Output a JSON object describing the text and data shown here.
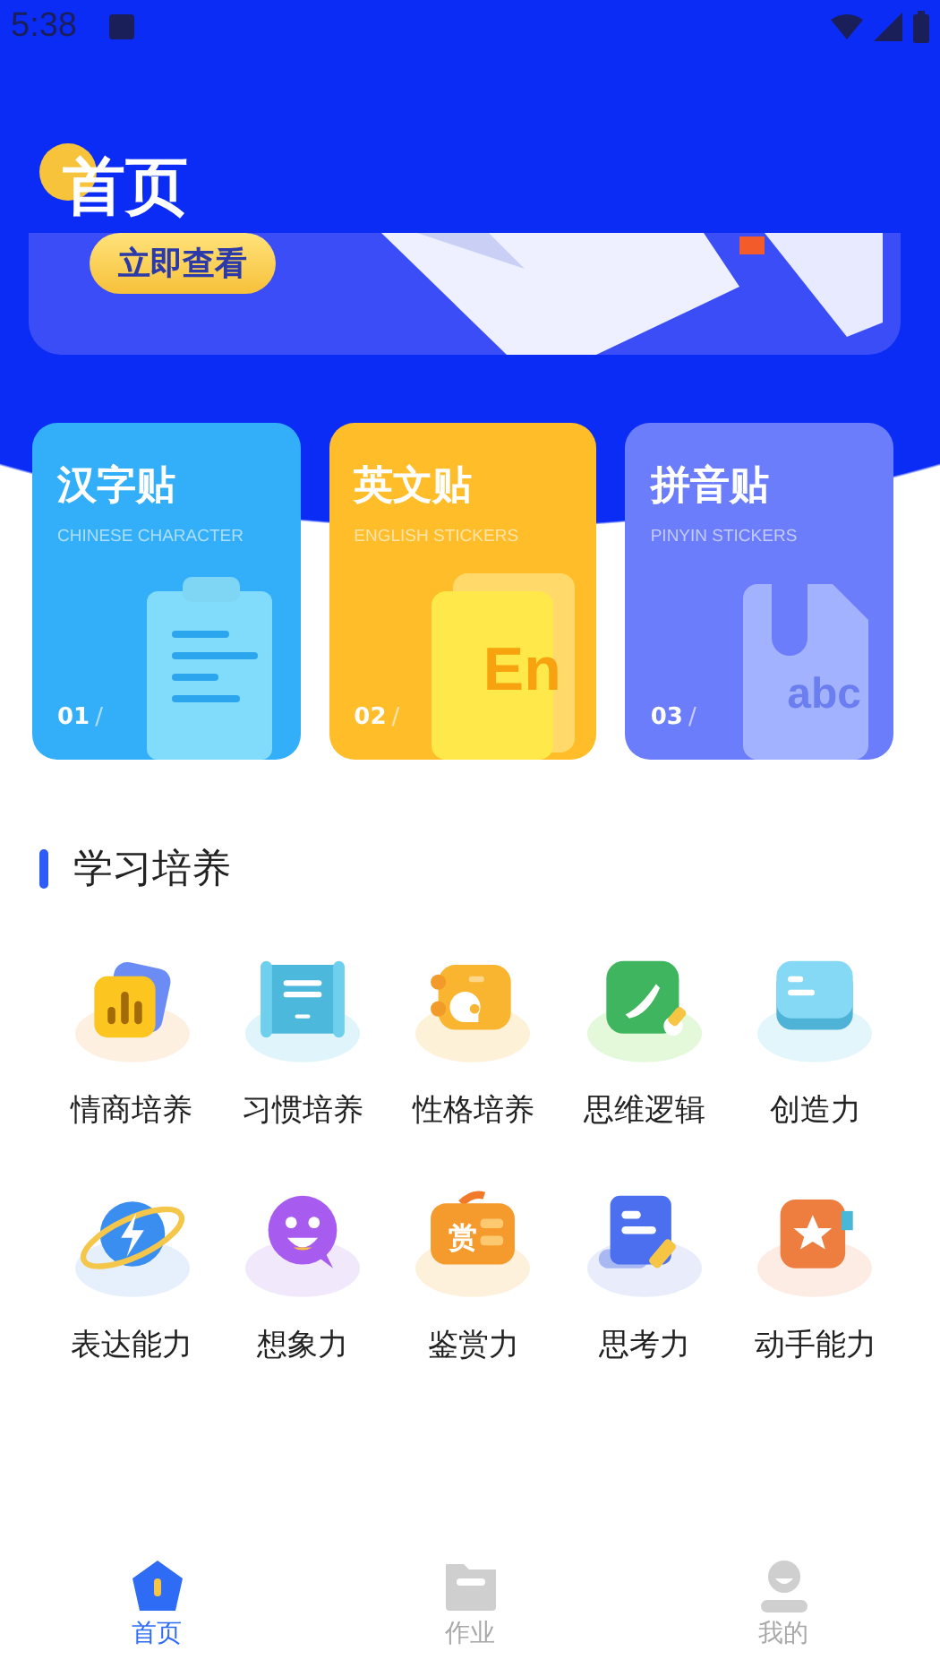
{
  "status_bar": {
    "time": "5:38"
  },
  "header": {
    "title": "首页"
  },
  "banner": {
    "button": "立即查看"
  },
  "cards": [
    {
      "kind": "clipboard",
      "title": "汉字贴",
      "subtitle": "CHINESE CHARACTER",
      "number": "01",
      "separator": "/",
      "color": "#33aef9"
    },
    {
      "kind": "letter-book",
      "title": "英文贴",
      "subtitle": "ENGLISH STICKERS",
      "number": "02",
      "separator": "/",
      "color": "#ffbd2a",
      "illustration_text": "En"
    },
    {
      "kind": "letter-folder",
      "title": "拼音贴",
      "subtitle": "PINYIN STICKERS",
      "number": "03",
      "separator": "/",
      "color": "#6b7dfb",
      "illustration_text": "abc"
    }
  ],
  "section": {
    "title": "学习培养"
  },
  "skills": [
    {
      "kind": "chart",
      "label": "情商培养"
    },
    {
      "kind": "scroll",
      "label": "习惯培养"
    },
    {
      "kind": "notebook",
      "label": "性格培养"
    },
    {
      "kind": "tablet",
      "label": "思维逻辑"
    },
    {
      "kind": "book",
      "label": "创造力"
    },
    {
      "kind": "planet",
      "label": "表达能力"
    },
    {
      "kind": "smiley",
      "label": "想象力"
    },
    {
      "kind": "award",
      "label": "鉴赏力",
      "icon_text": "赏"
    },
    {
      "kind": "document",
      "label": "思考力"
    },
    {
      "kind": "star",
      "label": "动手能力"
    }
  ],
  "tab_bar": [
    {
      "kind": "home",
      "label": "首页",
      "selected": true
    },
    {
      "kind": "folder",
      "label": "作业",
      "selected": false
    },
    {
      "kind": "person",
      "label": "我的",
      "selected": false
    }
  ]
}
